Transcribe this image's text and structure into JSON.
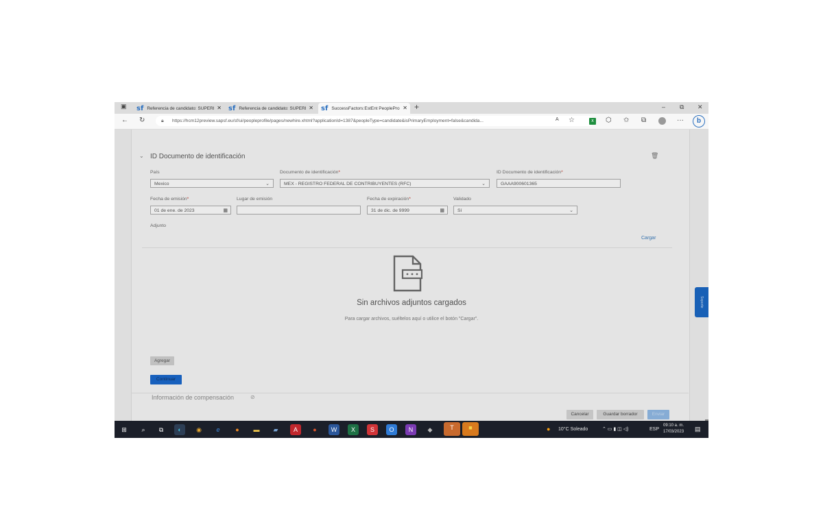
{
  "browser": {
    "tabs": [
      {
        "title": "Referencia de candidato: SUPERI",
        "icon": "sf"
      },
      {
        "title": "Referencia de candidato: SUPERI",
        "icon": "sf"
      },
      {
        "title": "SuccessFactors:EstEnt PeoplePro",
        "icon": "sf"
      }
    ],
    "url": "https://hcm12preview.sapsf.eu/sf/ui/peopleprofile/pages/newhire.xhtml?applicationId=1387&peopleType=candidate&isPrimaryEmployment=false&candida..."
  },
  "section": {
    "title": "ID Documento de identificación",
    "fields": {
      "pais_label": "País",
      "pais_value": "Mexico",
      "documento_label": "Documento de identificación",
      "documento_value": "MEX - REGISTRO FEDERAL DE CONTRIBUYENTES (RFC)",
      "id_label": "ID Documento de identificación",
      "id_value": "GAAA900601365",
      "emision_label": "Fecha de emisión",
      "emision_value": "01 de ene. de 2023",
      "lugar_label": "Lugar de emisión",
      "lugar_value": "",
      "expiracion_label": "Fecha de expiración",
      "expiracion_value": "31 de dic. de 9999",
      "validado_label": "Validado",
      "validado_value": "Sí"
    },
    "adjunto_label": "Adjunto",
    "cargar_link": "Cargar",
    "empty_title": "Sin archivos adjuntos cargados",
    "empty_hint": "Para cargar archivos, suéltelos aquí o utilice el botón \"Cargar\".",
    "agregar": "Agregar",
    "continuar": "Continuar"
  },
  "next_section": {
    "title": "Información de compensación"
  },
  "footer": {
    "cancelar": "Cancelar",
    "guardar_borrador": "Guardar borrador",
    "enviar": "Enviar"
  },
  "side_tab": "Soporte",
  "taskbar": {
    "weather": "10°C Soleado",
    "lang": "ESP",
    "time": "09:10 a. m.",
    "date": "17/03/2023"
  },
  "colors": {
    "accent": "#1a66c2",
    "link": "#3a79b8"
  }
}
